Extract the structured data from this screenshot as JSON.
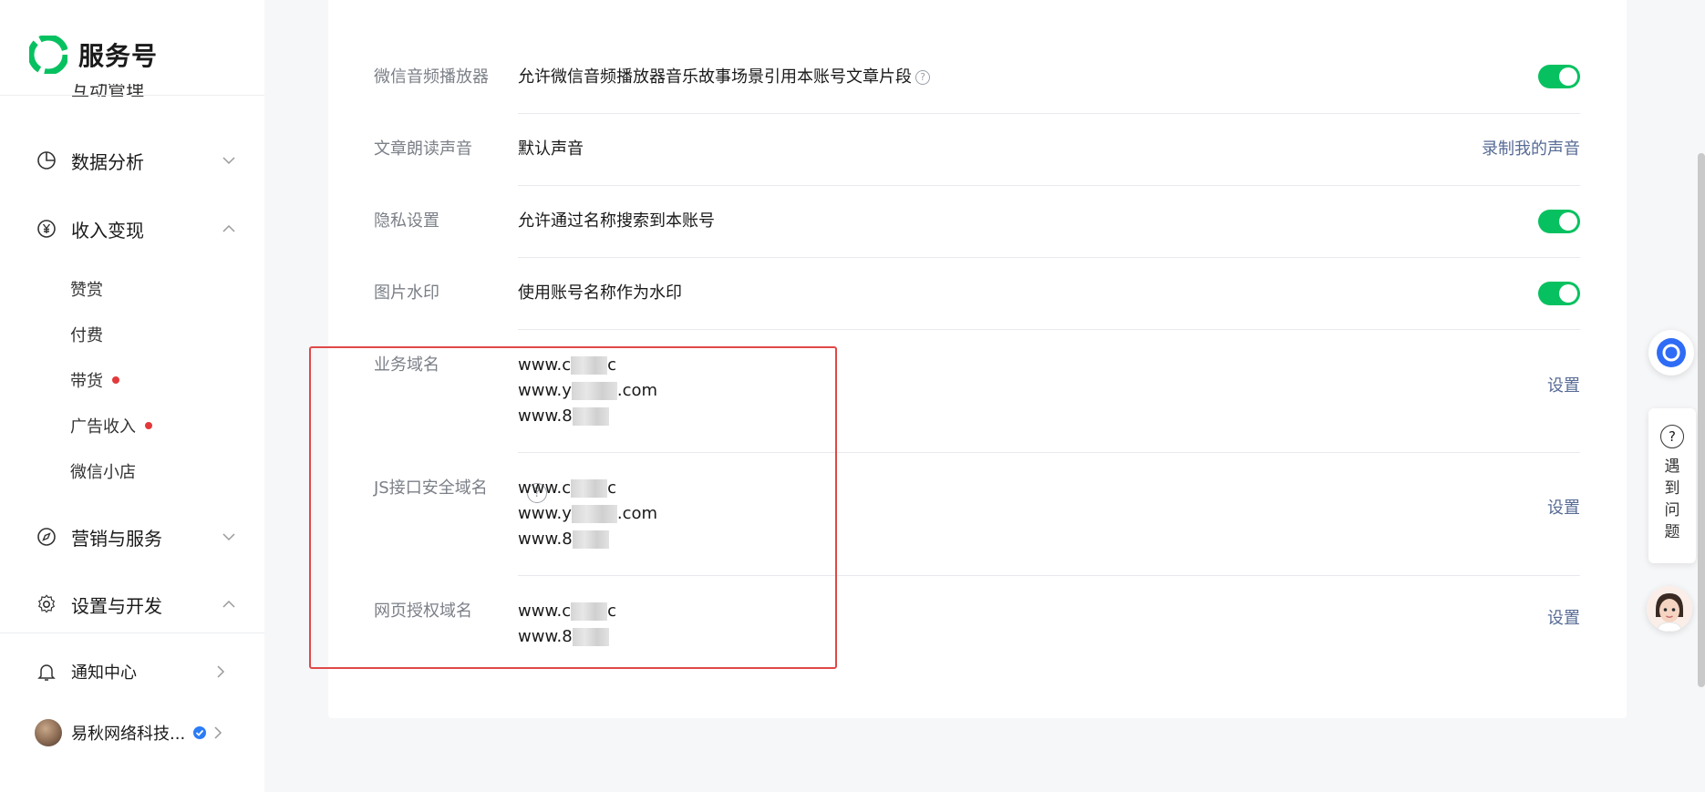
{
  "brand": {
    "name": "服务号"
  },
  "sidebar": {
    "partial_item": "互动管理",
    "items": [
      {
        "label": "数据分析",
        "expanded": false
      },
      {
        "label": "收入变现",
        "expanded": true
      },
      {
        "label": "营销与服务",
        "expanded": false
      },
      {
        "label": "设置与开发",
        "expanded": true
      }
    ],
    "sub_items": [
      {
        "label": "赞赏",
        "dot": false
      },
      {
        "label": "付费",
        "dot": false
      },
      {
        "label": "带货",
        "dot": true
      },
      {
        "label": "广告收入",
        "dot": true
      },
      {
        "label": "微信小店",
        "dot": false
      }
    ],
    "notify": "通知中心",
    "account": "易秋网络科技..."
  },
  "settings": {
    "audio_player": {
      "label": "微信音频播放器",
      "value": "允许微信音频播放器音乐故事场景引用本账号文章片段",
      "enabled": true
    },
    "read_voice": {
      "label": "文章朗读声音",
      "value": "默认声音",
      "action": "录制我的声音"
    },
    "privacy": {
      "label": "隐私设置",
      "value": "允许通过名称搜索到本账号",
      "enabled": true
    },
    "watermark": {
      "label": "图片水印",
      "value": "使用账号名称作为水印",
      "enabled": true
    },
    "business_domain": {
      "label": "业务域名",
      "domains": [
        {
          "prefix": "www.c",
          "suffix": "c"
        },
        {
          "prefix": "www.y",
          "suffix": ".com"
        },
        {
          "prefix": "www.8",
          "suffix": ""
        }
      ],
      "action": "设置"
    },
    "js_domain": {
      "label": "JS接口安全域名",
      "help": "?",
      "domains": [
        {
          "prefix": "www.c",
          "suffix": "c"
        },
        {
          "prefix": "www.y",
          "suffix": ".com"
        },
        {
          "prefix": "www.8",
          "suffix": ""
        }
      ],
      "action": "设置"
    },
    "web_auth_domain": {
      "label": "网页授权域名",
      "domains": [
        {
          "prefix": "www.c",
          "suffix": "c"
        },
        {
          "prefix": "www.8",
          "suffix": ""
        }
      ],
      "action": "设置"
    }
  },
  "help_panel": {
    "icon": "?",
    "chars": [
      "遇",
      "到",
      "问",
      "题"
    ]
  },
  "colors": {
    "accent_green": "#07c160",
    "link_blue": "#576b95",
    "highlight_red": "#e04848",
    "badge_red": "#e3393b"
  }
}
